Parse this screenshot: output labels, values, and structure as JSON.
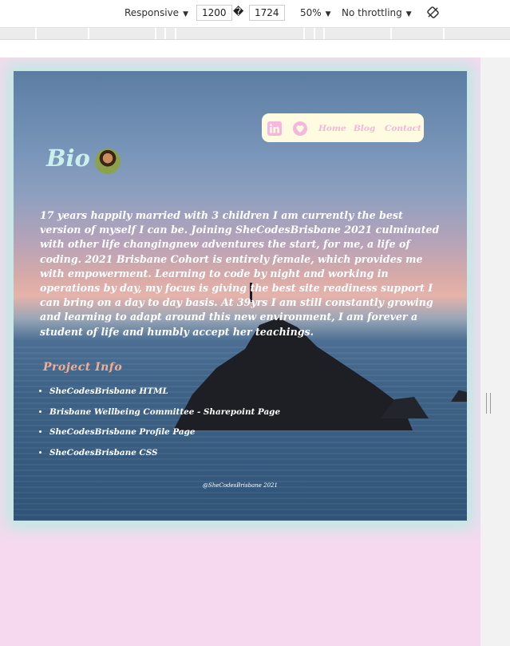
{
  "devtools": {
    "device": "Responsive",
    "width": "1200",
    "separator": "�",
    "height": "1724",
    "zoom": "50%",
    "throttling": "No throttling"
  },
  "page": {
    "nav": {
      "home": "Home",
      "blog": "Blog",
      "contact": "Contact"
    },
    "title": "Bio",
    "bio": "17 years happily married with 3 children I am currently the best version of myself I can be. Joining SheCodesBrisbane 2021 culminated with other life changingnew adventures the start, for me, a life of coding. 2021 Brisbane Cohort is entirely female, which provides me with empowerment. Learning to code by night and working in operations by day, my focus is giving the best site readiness support I can bring on a day to day basis. At 39yrs I am still constantly growing and learning to adapt around this new environment, I am forever a student of life and humbly accept her teachings.",
    "project_heading": "Project Info",
    "projects": [
      "SheCodesBrisbane HTML",
      "Brisbane Wellbeing Committee - Sharepoint Page",
      "SheCodesBrisbane Profile Page",
      "SheCodesBrisbane CSS"
    ],
    "footer": "@SheCodesBrisbane 2021"
  },
  "icons": {
    "linkedin": "linkedin-icon",
    "other": "heart-location-icon",
    "rotate": "rotate-icon"
  },
  "colors": {
    "nav_bg": "#fffbe0",
    "nav_link": "#f5b7dd",
    "title": "#c9f0ec",
    "project_heading": "#f2ad92",
    "page_bg": "#f6d9ee",
    "glow": "#bfe9e4"
  }
}
